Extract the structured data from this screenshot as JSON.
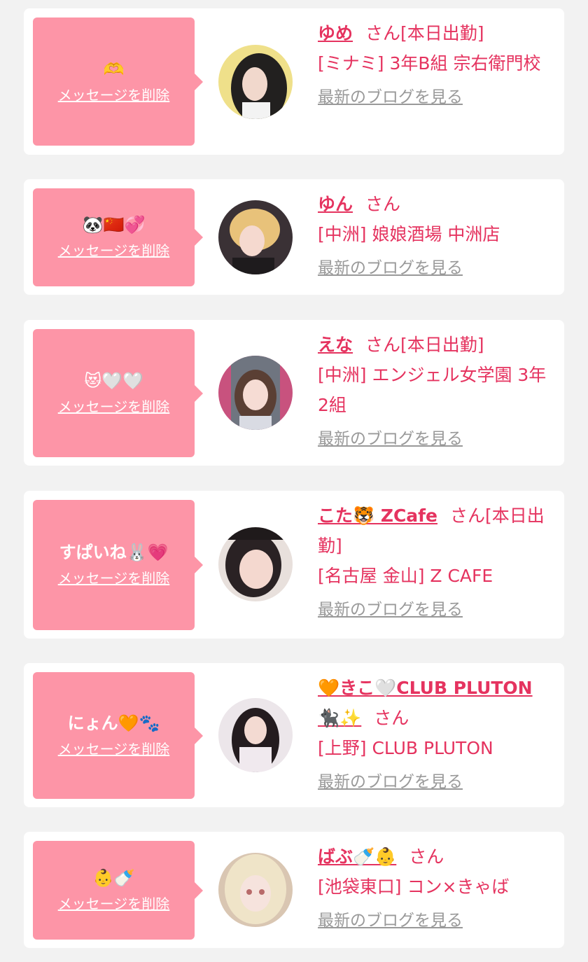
{
  "common": {
    "delete_label": "メッセージを削除",
    "san_label": "さん",
    "blog_label": "最新のブログを見る"
  },
  "cards": [
    {
      "message": "🫶",
      "name": "ゆめ",
      "status": "[本日出勤]",
      "shop": "[ミナミ] 3年B組 宗右衛門校"
    },
    {
      "message": "🐼🇨🇳💞",
      "name": "ゆん",
      "status": "",
      "shop": "[中洲] 娘娘酒場 中洲店"
    },
    {
      "message": "😻🤍🤍",
      "name": "えな",
      "status": "[本日出勤]",
      "shop": "[中洲] エンジェル女学園 3年2組"
    },
    {
      "message": "すぱいね🐰💗",
      "name": "こた🐯 ZCafe",
      "status": "[本日出勤]",
      "shop": "[名古屋 金山] Z CAFE"
    },
    {
      "message": "にょん🧡🐾",
      "name": "🧡きこ🤍CLUB PLUTON 🐈‍⬛✨",
      "status": "",
      "shop": "[上野] CLUB PLUTON"
    },
    {
      "message": "👶🍼",
      "name": "ばぶ🍼👶",
      "status": "",
      "shop": "[池袋東口] コン×きゃば"
    }
  ],
  "colors": {
    "background": "#f2f2f2",
    "bubble": "#fd95a7",
    "accent": "#e5335f",
    "link_gray": "#999999"
  }
}
